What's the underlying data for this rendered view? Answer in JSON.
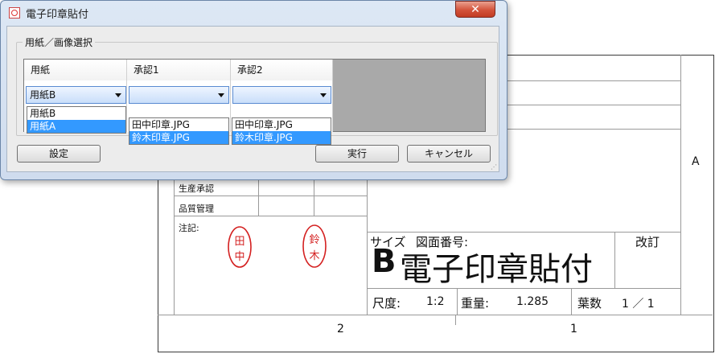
{
  "window": {
    "title": "電子印章貼付",
    "close_label": "✕"
  },
  "group": {
    "label": "用紙／画像選択"
  },
  "columns": [
    {
      "header": "用紙",
      "selected": "用紙B",
      "options": [
        "用紙B",
        "用紙A"
      ]
    },
    {
      "header": "承認1",
      "selected": "",
      "options": [
        "田中印章.JPG",
        "鈴木印章.JPG"
      ]
    },
    {
      "header": "承認2",
      "selected": "",
      "options": [
        "田中印章.JPG",
        "鈴木印章.JPG"
      ]
    }
  ],
  "buttons": {
    "settings": "設定",
    "run": "実行",
    "cancel": "キャンセル"
  },
  "sheet": {
    "row_production": "生産承認",
    "row_quality": "品質管理",
    "notes_label": "注記:",
    "stamp_tanaka": [
      "田",
      "中"
    ],
    "stamp_suzuki": [
      "鈴",
      "木"
    ],
    "zone_a": "A",
    "size_label": "サイズ",
    "drawing_number_label": "図面番号:",
    "revision_label": "改訂",
    "size_value": "B",
    "drawing_number": "電子印章貼付",
    "scale_label": "尺度:",
    "scale_value": "1:2",
    "weight_label": "重量:",
    "weight_value": "1.285",
    "sheet_label": "葉数",
    "sheet_value": "1 ／ 1",
    "zone_2": "2",
    "zone_1": "1"
  },
  "colors": {
    "stamp_red": "#d42020",
    "selection_blue": "#3399ff"
  }
}
